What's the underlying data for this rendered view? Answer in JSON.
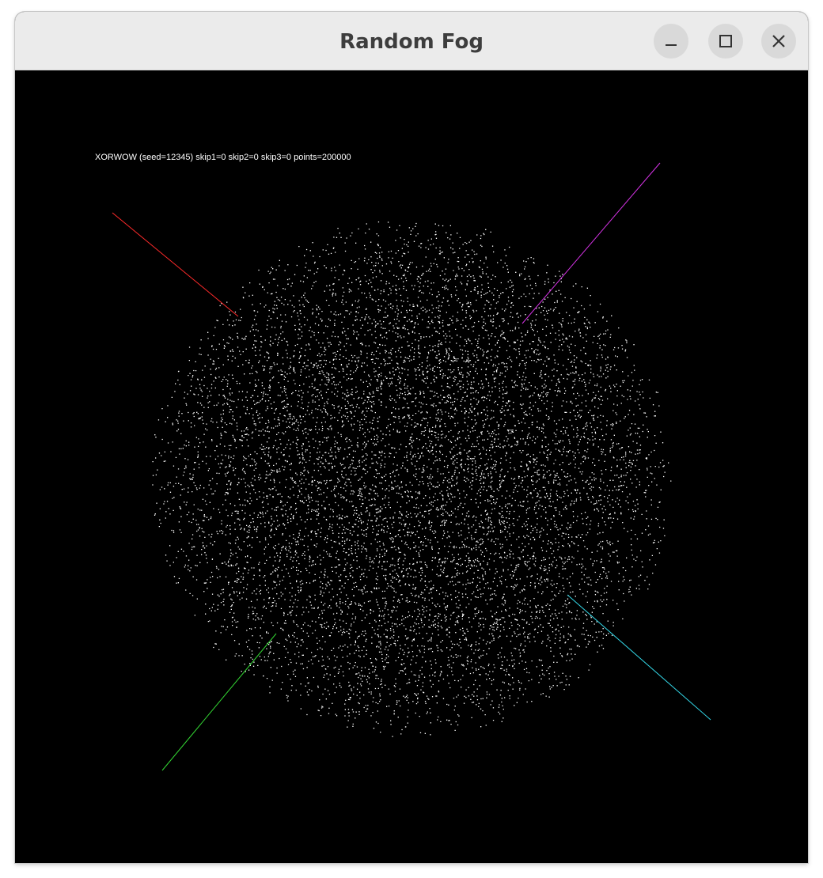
{
  "window": {
    "title": "Random Fog",
    "controls": [
      "minimize",
      "maximize",
      "close"
    ]
  },
  "canvas": {
    "background": "#000000",
    "caption": "XORWOW (seed=12345) skip1=0 skip2=0 skip3=0 points=200000",
    "point_color": "#ffffff",
    "axes": [
      {
        "name": "red-axis",
        "color": "#ff2a2a"
      },
      {
        "name": "magenta-axis",
        "color": "#d633e6"
      },
      {
        "name": "green-axis",
        "color": "#33d633"
      },
      {
        "name": "cyan-axis",
        "color": "#33d6e6"
      }
    ]
  },
  "icons": {
    "minimize": "minimize-icon",
    "maximize": "maximize-icon",
    "close": "close-icon"
  }
}
